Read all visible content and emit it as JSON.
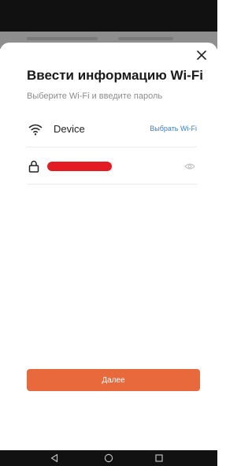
{
  "dialog": {
    "title": "Ввести информацию Wi-Fi",
    "subtitle": "Выберите Wi-Fi и введите пароль",
    "close_icon": "close-icon"
  },
  "wifi": {
    "icon": "wifi-icon",
    "ssid": "Device",
    "choose_label": "Выбрать Wi-Fi"
  },
  "password": {
    "icon": "lock-icon",
    "visibility_icon": "eye-icon"
  },
  "actions": {
    "next_label": "Далее",
    "next_color": "#e8693b"
  },
  "navigation": {
    "icons": [
      "back-triangle-icon",
      "home-circle-icon",
      "recents-square-icon"
    ]
  },
  "colors": {
    "accent_link": "#3a7fd0",
    "redaction": "#e31c24"
  }
}
